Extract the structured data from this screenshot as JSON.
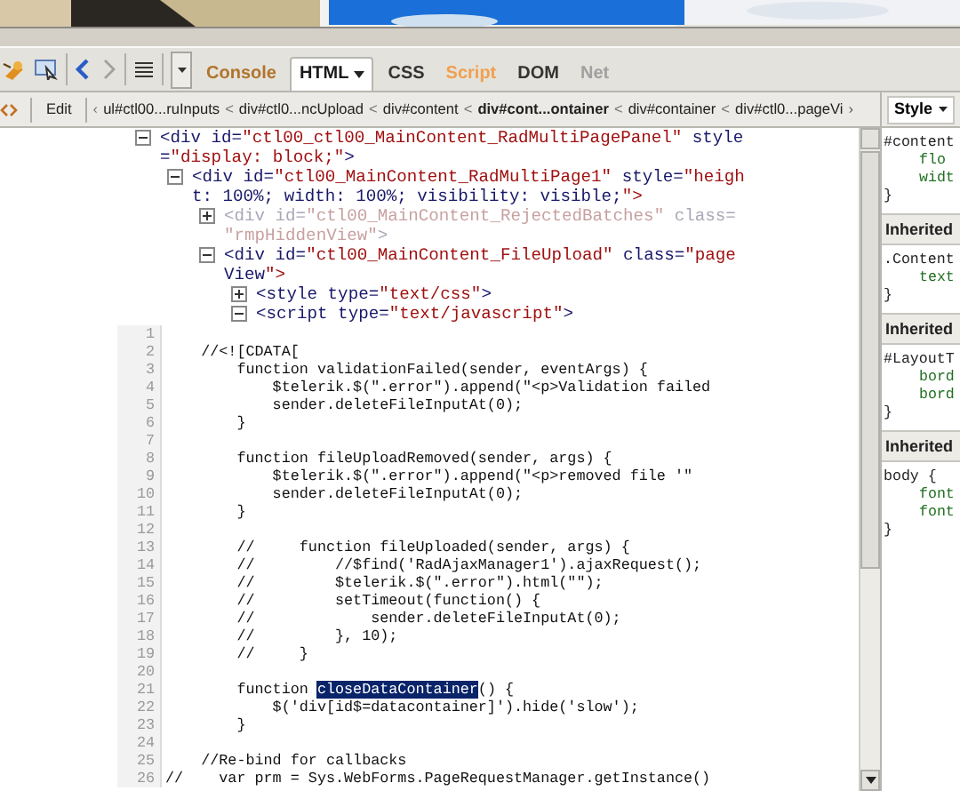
{
  "toolbar": {
    "tabs": [
      {
        "label": "Console",
        "selected": false,
        "color": "#b0742c",
        "dropdown": false
      },
      {
        "label": "HTML",
        "selected": true,
        "color": "#1a1a1a",
        "dropdown": true
      },
      {
        "label": "CSS",
        "selected": false,
        "color": "#333333",
        "dropdown": false
      },
      {
        "label": "Script",
        "selected": false,
        "color": "#f0a050",
        "dropdown": false
      },
      {
        "label": "DOM",
        "selected": false,
        "color": "#333333",
        "dropdown": false
      },
      {
        "label": "Net",
        "selected": false,
        "color": "#a0a0a0",
        "dropdown": false
      }
    ]
  },
  "breadcrumb": {
    "edit": "Edit",
    "scroll_left": "‹",
    "scroll_right": "›",
    "items": [
      {
        "label": "ul#ctl00...ruInputs",
        "selected": false
      },
      {
        "label": "div#ctl0...ncUpload",
        "selected": false
      },
      {
        "label": "div#content",
        "selected": false
      },
      {
        "label": "div#cont...ontainer",
        "selected": true
      },
      {
        "label": "div#container",
        "selected": false
      },
      {
        "label": "div#ctl0...pageVi",
        "selected": false
      }
    ],
    "separator": "<"
  },
  "tree": [
    {
      "lines": [
        "<div id=\"ctl00_ctl00_MainContent_RadMultiPagePanel\" style",
        "=\"display: block;\">"
      ],
      "expanded": true,
      "hidden": false,
      "children": [
        {
          "lines": [
            "<div id=\"ctl00_MainContent_RadMultiPage1\" style=\"heigh",
            "t: 100%; width: 100%; visibility: visible;\">"
          ],
          "expanded": true,
          "hidden": false,
          "children": [
            {
              "lines": [
                "<div id=\"ctl00_MainContent_RejectedBatches\" class=",
                "\"rmpHiddenView\">"
              ],
              "expanded": false,
              "hidden": true
            },
            {
              "lines": [
                "<div id=\"ctl00_MainContent_FileUpload\" class=\"page",
                "View\">"
              ],
              "expanded": true,
              "hidden": false,
              "children": [
                {
                  "lines": [
                    "<style type=\"text/css\">"
                  ],
                  "expanded": false,
                  "hidden": false
                },
                {
                  "lines": [
                    "<script type=\"text/javascript\">"
                  ],
                  "expanded": true,
                  "hidden": false,
                  "code": [
                    {
                      "n": "1"
                    },
                    {
                      "n": "2",
                      "text": "    //<![CDATA["
                    },
                    {
                      "n": "3",
                      "text": "        function validationFailed(sender, eventArgs) {"
                    },
                    {
                      "n": "4",
                      "text": "            $telerik.$(\".error\").append(\"<p>Validation failed"
                    },
                    {
                      "n": "5",
                      "text": "            sender.deleteFileInputAt(0);"
                    },
                    {
                      "n": "6",
                      "text": "        }"
                    },
                    {
                      "n": "7"
                    },
                    {
                      "n": "8",
                      "text": "        function fileUploadRemoved(sender, args) {"
                    },
                    {
                      "n": "9",
                      "text": "            $telerik.$(\".error\").append(\"<p>removed file '\""
                    },
                    {
                      "n": "10",
                      "text": "            sender.deleteFileInputAt(0);"
                    },
                    {
                      "n": "11",
                      "text": "        }"
                    },
                    {
                      "n": "12"
                    },
                    {
                      "n": "13",
                      "text": "        //     function fileUploaded(sender, args) {"
                    },
                    {
                      "n": "14",
                      "text": "        //         //$find('RadAjaxManager1').ajaxRequest();"
                    },
                    {
                      "n": "15",
                      "text": "        //         $telerik.$(\".error\").html(\"\");"
                    },
                    {
                      "n": "16",
                      "text": "        //         setTimeout(function() {"
                    },
                    {
                      "n": "17",
                      "text": "        //             sender.deleteFileInputAt(0);"
                    },
                    {
                      "n": "18",
                      "text": "        //         }, 10);"
                    },
                    {
                      "n": "19",
                      "text": "        //     }"
                    },
                    {
                      "n": "20"
                    },
                    {
                      "n": "21",
                      "text": "        function ",
                      "highlight": "closeDataContainer",
                      "after": "() {"
                    },
                    {
                      "n": "22",
                      "text": "            $('div[id$=datacontainer]').hide('slow');"
                    },
                    {
                      "n": "23",
                      "text": "        }"
                    },
                    {
                      "n": "24"
                    },
                    {
                      "n": "25",
                      "text": "    //Re-bind for callbacks"
                    },
                    {
                      "n": "26",
                      "text": "//    var prm = Sys.WebForms.PageRequestManager.getInstance()"
                    }
                  ]
                }
              ]
            }
          ]
        }
      ]
    }
  ],
  "side_panel": {
    "menu": "Style",
    "sections": [
      {
        "rule": [
          "#content",
          "flo",
          "widt",
          "}"
        ]
      },
      {
        "header": "Inherited",
        "rule": [
          ".Content",
          "text",
          "}"
        ]
      },
      {
        "header": "Inherited",
        "rule": [
          "#LayoutT",
          "bord",
          "bord",
          "}"
        ]
      },
      {
        "header": "Inherited",
        "rule": [
          "body {",
          "font",
          "font",
          "}"
        ]
      }
    ]
  }
}
